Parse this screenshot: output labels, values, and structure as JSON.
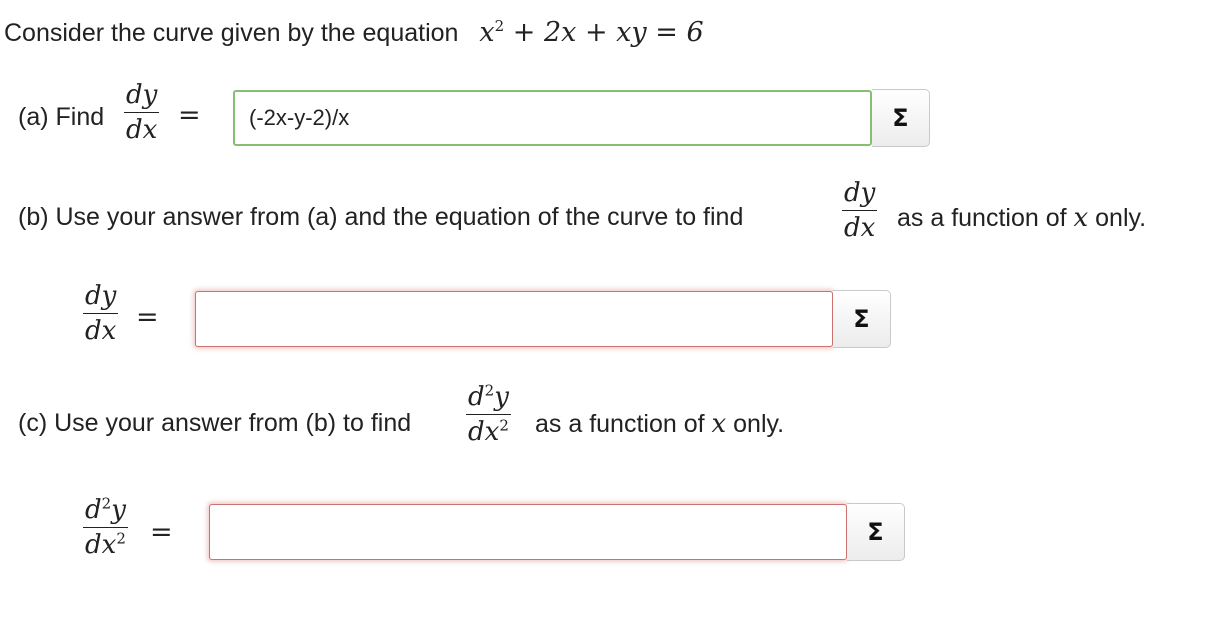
{
  "intro": {
    "label": "Consider the curve given by the equation",
    "equation": {
      "x": "x",
      "power": "2",
      "rest": " + 2x + xy = 6"
    }
  },
  "part_a": {
    "label": "(a) Find",
    "frac_num": "dy",
    "frac_den": "dx",
    "equals": "=",
    "input_value": "(-2x-y-2)/x",
    "input_status": "correct"
  },
  "part_b": {
    "label": "(b) Use your answer from (a) and the equation of the curve to find",
    "frac_num": "dy",
    "frac_den": "dx",
    "suffix_prefix": "as a function of",
    "suffix_var": "x",
    "suffix_end": "only.",
    "answer": {
      "frac_num": "dy",
      "frac_den": "dx",
      "equals": "=",
      "input_value": "",
      "input_status": "incorrect"
    }
  },
  "part_c": {
    "label": "(c) Use your answer from (b) to find",
    "frac_num_d": "d",
    "frac_num_pow": "2",
    "frac_num_y": "y",
    "frac_den_dx": "dx",
    "frac_den_pow": "2",
    "suffix_prefix": "as a function of",
    "suffix_var": "x",
    "suffix_end": "only.",
    "answer": {
      "frac_num_d": "d",
      "frac_num_pow": "2",
      "frac_num_y": "y",
      "frac_den_dx": "dx",
      "frac_den_pow": "2",
      "equals": "=",
      "input_value": "",
      "input_status": "incorrect"
    }
  },
  "sigma_button": {
    "label": "Σ",
    "icon": "sigma-icon"
  },
  "colors": {
    "correct_border": "#86bf73",
    "incorrect_border": "#c9726e"
  }
}
